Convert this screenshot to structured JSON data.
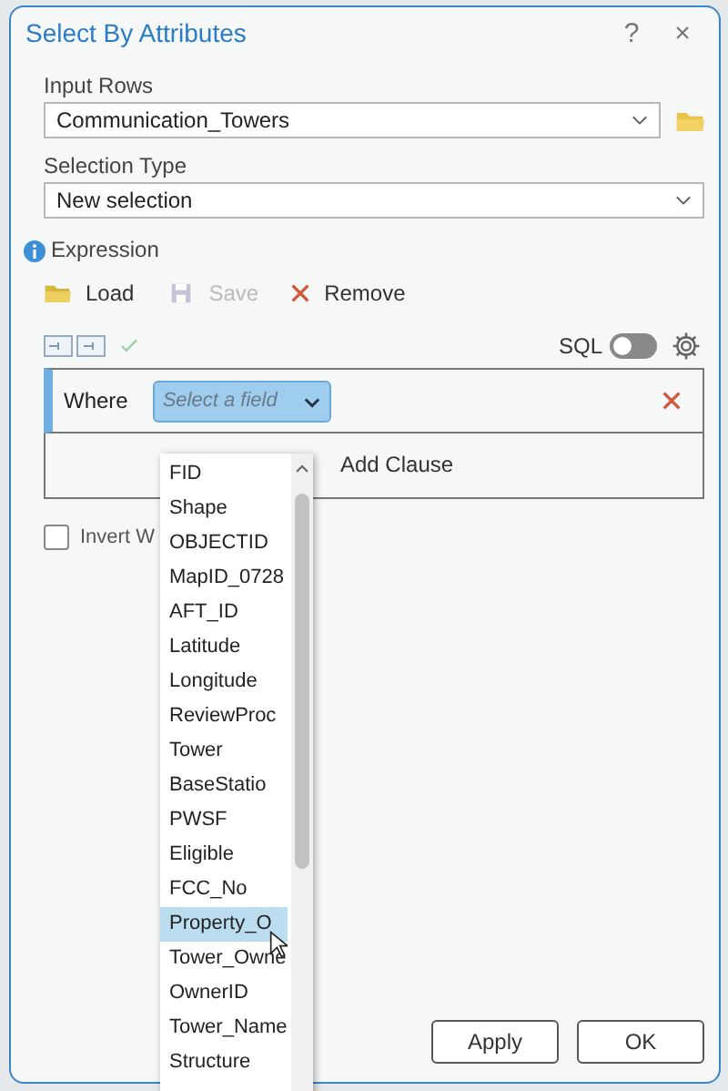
{
  "window": {
    "title": "Select By Attributes",
    "help": "?",
    "close": "×"
  },
  "input_rows": {
    "label": "Input Rows",
    "value": "Communication_Towers"
  },
  "selection_type": {
    "label": "Selection Type",
    "value": "New selection"
  },
  "expression": {
    "label": "Expression",
    "actions": [
      {
        "kind": "load",
        "label": "Load",
        "disabled": false
      },
      {
        "kind": "save",
        "label": "Save",
        "disabled": true
      },
      {
        "kind": "remove",
        "label": "Remove",
        "disabled": false
      }
    ],
    "sql": {
      "label": "SQL",
      "on": false
    },
    "clause": {
      "label": "Where",
      "placeholder": "Select a field"
    },
    "add_clause": "Add Clause"
  },
  "invert": {
    "label": "Invert W",
    "checked": false
  },
  "field_list": [
    {
      "label": "FID",
      "selected": false
    },
    {
      "label": "Shape",
      "selected": false
    },
    {
      "label": "OBJECTID",
      "selected": false
    },
    {
      "label": "MapID_0728",
      "selected": false
    },
    {
      "label": "AFT_ID",
      "selected": false
    },
    {
      "label": "Latitude",
      "selected": false
    },
    {
      "label": "Longitude",
      "selected": false
    },
    {
      "label": "ReviewProc",
      "selected": false
    },
    {
      "label": "Tower",
      "selected": false
    },
    {
      "label": "BaseStatio",
      "selected": false
    },
    {
      "label": "PWSF",
      "selected": false
    },
    {
      "label": "Eligible",
      "selected": false
    },
    {
      "label": "FCC_No",
      "selected": false
    },
    {
      "label": "Property_O",
      "selected": true
    },
    {
      "label": "Tower_Owne",
      "selected": false
    },
    {
      "label": "OwnerID",
      "selected": false
    },
    {
      "label": "Tower_Name",
      "selected": false
    },
    {
      "label": "Structure",
      "selected": false
    }
  ],
  "buttons": [
    "Apply",
    "OK"
  ]
}
